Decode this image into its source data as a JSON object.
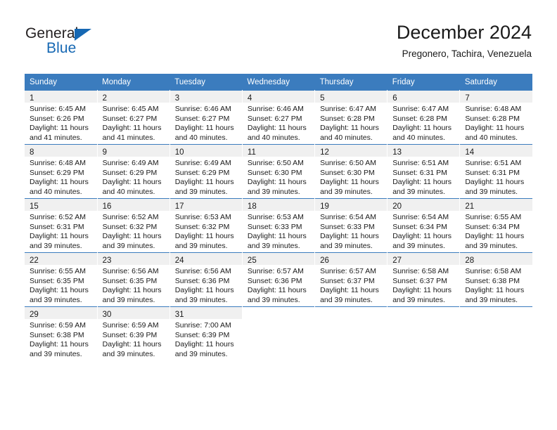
{
  "brand": {
    "name_dark": "General",
    "name_blue": "Blue",
    "triangle_color": "#1668b3",
    "icon": "triangle-logo-icon"
  },
  "header": {
    "title": "December 2024",
    "subtitle": "Pregonero, Tachira, Venezuela"
  },
  "theme": {
    "header_blue": "#3b7cbe",
    "daynum_strip": "#f0f0f0",
    "text": "#1a1a1a"
  },
  "calendar": {
    "weekday_headers": [
      "Sunday",
      "Monday",
      "Tuesday",
      "Wednesday",
      "Thursday",
      "Friday",
      "Saturday"
    ],
    "weeks": [
      [
        {
          "day": "1",
          "sunrise": "Sunrise: 6:45 AM",
          "sunset": "Sunset: 6:26 PM",
          "daylight1": "Daylight: 11 hours",
          "daylight2": "and 41 minutes."
        },
        {
          "day": "2",
          "sunrise": "Sunrise: 6:45 AM",
          "sunset": "Sunset: 6:27 PM",
          "daylight1": "Daylight: 11 hours",
          "daylight2": "and 41 minutes."
        },
        {
          "day": "3",
          "sunrise": "Sunrise: 6:46 AM",
          "sunset": "Sunset: 6:27 PM",
          "daylight1": "Daylight: 11 hours",
          "daylight2": "and 40 minutes."
        },
        {
          "day": "4",
          "sunrise": "Sunrise: 6:46 AM",
          "sunset": "Sunset: 6:27 PM",
          "daylight1": "Daylight: 11 hours",
          "daylight2": "and 40 minutes."
        },
        {
          "day": "5",
          "sunrise": "Sunrise: 6:47 AM",
          "sunset": "Sunset: 6:28 PM",
          "daylight1": "Daylight: 11 hours",
          "daylight2": "and 40 minutes."
        },
        {
          "day": "6",
          "sunrise": "Sunrise: 6:47 AM",
          "sunset": "Sunset: 6:28 PM",
          "daylight1": "Daylight: 11 hours",
          "daylight2": "and 40 minutes."
        },
        {
          "day": "7",
          "sunrise": "Sunrise: 6:48 AM",
          "sunset": "Sunset: 6:28 PM",
          "daylight1": "Daylight: 11 hours",
          "daylight2": "and 40 minutes."
        }
      ],
      [
        {
          "day": "8",
          "sunrise": "Sunrise: 6:48 AM",
          "sunset": "Sunset: 6:29 PM",
          "daylight1": "Daylight: 11 hours",
          "daylight2": "and 40 minutes."
        },
        {
          "day": "9",
          "sunrise": "Sunrise: 6:49 AM",
          "sunset": "Sunset: 6:29 PM",
          "daylight1": "Daylight: 11 hours",
          "daylight2": "and 40 minutes."
        },
        {
          "day": "10",
          "sunrise": "Sunrise: 6:49 AM",
          "sunset": "Sunset: 6:29 PM",
          "daylight1": "Daylight: 11 hours",
          "daylight2": "and 39 minutes."
        },
        {
          "day": "11",
          "sunrise": "Sunrise: 6:50 AM",
          "sunset": "Sunset: 6:30 PM",
          "daylight1": "Daylight: 11 hours",
          "daylight2": "and 39 minutes."
        },
        {
          "day": "12",
          "sunrise": "Sunrise: 6:50 AM",
          "sunset": "Sunset: 6:30 PM",
          "daylight1": "Daylight: 11 hours",
          "daylight2": "and 39 minutes."
        },
        {
          "day": "13",
          "sunrise": "Sunrise: 6:51 AM",
          "sunset": "Sunset: 6:31 PM",
          "daylight1": "Daylight: 11 hours",
          "daylight2": "and 39 minutes."
        },
        {
          "day": "14",
          "sunrise": "Sunrise: 6:51 AM",
          "sunset": "Sunset: 6:31 PM",
          "daylight1": "Daylight: 11 hours",
          "daylight2": "and 39 minutes."
        }
      ],
      [
        {
          "day": "15",
          "sunrise": "Sunrise: 6:52 AM",
          "sunset": "Sunset: 6:31 PM",
          "daylight1": "Daylight: 11 hours",
          "daylight2": "and 39 minutes."
        },
        {
          "day": "16",
          "sunrise": "Sunrise: 6:52 AM",
          "sunset": "Sunset: 6:32 PM",
          "daylight1": "Daylight: 11 hours",
          "daylight2": "and 39 minutes."
        },
        {
          "day": "17",
          "sunrise": "Sunrise: 6:53 AM",
          "sunset": "Sunset: 6:32 PM",
          "daylight1": "Daylight: 11 hours",
          "daylight2": "and 39 minutes."
        },
        {
          "day": "18",
          "sunrise": "Sunrise: 6:53 AM",
          "sunset": "Sunset: 6:33 PM",
          "daylight1": "Daylight: 11 hours",
          "daylight2": "and 39 minutes."
        },
        {
          "day": "19",
          "sunrise": "Sunrise: 6:54 AM",
          "sunset": "Sunset: 6:33 PM",
          "daylight1": "Daylight: 11 hours",
          "daylight2": "and 39 minutes."
        },
        {
          "day": "20",
          "sunrise": "Sunrise: 6:54 AM",
          "sunset": "Sunset: 6:34 PM",
          "daylight1": "Daylight: 11 hours",
          "daylight2": "and 39 minutes."
        },
        {
          "day": "21",
          "sunrise": "Sunrise: 6:55 AM",
          "sunset": "Sunset: 6:34 PM",
          "daylight1": "Daylight: 11 hours",
          "daylight2": "and 39 minutes."
        }
      ],
      [
        {
          "day": "22",
          "sunrise": "Sunrise: 6:55 AM",
          "sunset": "Sunset: 6:35 PM",
          "daylight1": "Daylight: 11 hours",
          "daylight2": "and 39 minutes."
        },
        {
          "day": "23",
          "sunrise": "Sunrise: 6:56 AM",
          "sunset": "Sunset: 6:35 PM",
          "daylight1": "Daylight: 11 hours",
          "daylight2": "and 39 minutes."
        },
        {
          "day": "24",
          "sunrise": "Sunrise: 6:56 AM",
          "sunset": "Sunset: 6:36 PM",
          "daylight1": "Daylight: 11 hours",
          "daylight2": "and 39 minutes."
        },
        {
          "day": "25",
          "sunrise": "Sunrise: 6:57 AM",
          "sunset": "Sunset: 6:36 PM",
          "daylight1": "Daylight: 11 hours",
          "daylight2": "and 39 minutes."
        },
        {
          "day": "26",
          "sunrise": "Sunrise: 6:57 AM",
          "sunset": "Sunset: 6:37 PM",
          "daylight1": "Daylight: 11 hours",
          "daylight2": "and 39 minutes."
        },
        {
          "day": "27",
          "sunrise": "Sunrise: 6:58 AM",
          "sunset": "Sunset: 6:37 PM",
          "daylight1": "Daylight: 11 hours",
          "daylight2": "and 39 minutes."
        },
        {
          "day": "28",
          "sunrise": "Sunrise: 6:58 AM",
          "sunset": "Sunset: 6:38 PM",
          "daylight1": "Daylight: 11 hours",
          "daylight2": "and 39 minutes."
        }
      ],
      [
        {
          "day": "29",
          "sunrise": "Sunrise: 6:59 AM",
          "sunset": "Sunset: 6:38 PM",
          "daylight1": "Daylight: 11 hours",
          "daylight2": "and 39 minutes."
        },
        {
          "day": "30",
          "sunrise": "Sunrise: 6:59 AM",
          "sunset": "Sunset: 6:39 PM",
          "daylight1": "Daylight: 11 hours",
          "daylight2": "and 39 minutes."
        },
        {
          "day": "31",
          "sunrise": "Sunrise: 7:00 AM",
          "sunset": "Sunset: 6:39 PM",
          "daylight1": "Daylight: 11 hours",
          "daylight2": "and 39 minutes."
        },
        {
          "day": "",
          "sunrise": "",
          "sunset": "",
          "daylight1": "",
          "daylight2": ""
        },
        {
          "day": "",
          "sunrise": "",
          "sunset": "",
          "daylight1": "",
          "daylight2": ""
        },
        {
          "day": "",
          "sunrise": "",
          "sunset": "",
          "daylight1": "",
          "daylight2": ""
        },
        {
          "day": "",
          "sunrise": "",
          "sunset": "",
          "daylight1": "",
          "daylight2": ""
        }
      ]
    ]
  }
}
